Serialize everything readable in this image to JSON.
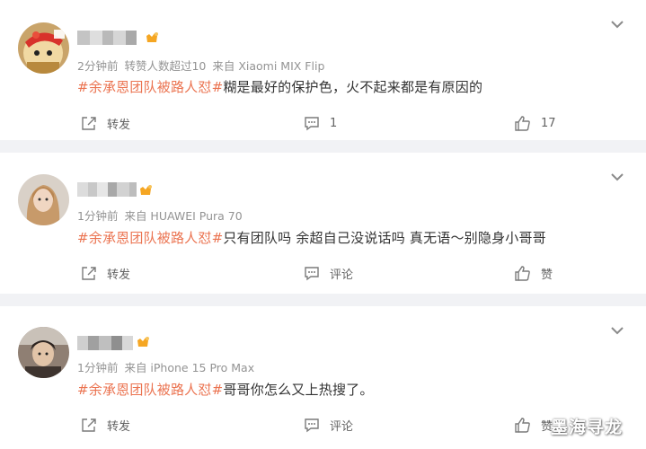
{
  "colors": {
    "background": "#f1f2f5",
    "card": "#ffffff",
    "hashtag": "#eb7350",
    "meta_text": "#939393",
    "body_text": "#333333",
    "action_text": "#636363"
  },
  "icons": {
    "more": "chevron-down-icon",
    "forward": "share-forward-icon",
    "comment": "comment-bubble-icon",
    "like": "thumbs-up-icon",
    "badge": "vip-badge-icon"
  },
  "posts": [
    {
      "username_masked": true,
      "time": "2分钟前",
      "repost_note": "转赞人数超过10",
      "source": "来自 Xiaomi MIX Flip",
      "hashtag": "#余承恩团队被路人怼#",
      "text": "糊是最好的保护色，火不起来都是有原因的",
      "forward_label": "转发",
      "comment_label": "1",
      "like_label": "17"
    },
    {
      "username_masked": true,
      "time": "1分钟前",
      "repost_note": "",
      "source": "来自 HUAWEI Pura 70",
      "hashtag": "#余承恩团队被路人怼#",
      "text": "只有团队吗 余超自己没说话吗 真无语～别隐身小哥哥",
      "forward_label": "转发",
      "comment_label": "评论",
      "like_label": "赞"
    },
    {
      "username_masked": true,
      "time": "1分钟前",
      "repost_note": "",
      "source": "来自 iPhone 15 Pro Max",
      "hashtag": "#余承恩团队被路人怼#",
      "text": "哥哥你怎么又上热搜了。",
      "forward_label": "转发",
      "comment_label": "评论",
      "like_label": "赞"
    }
  ],
  "watermark": "墨海寻龙"
}
